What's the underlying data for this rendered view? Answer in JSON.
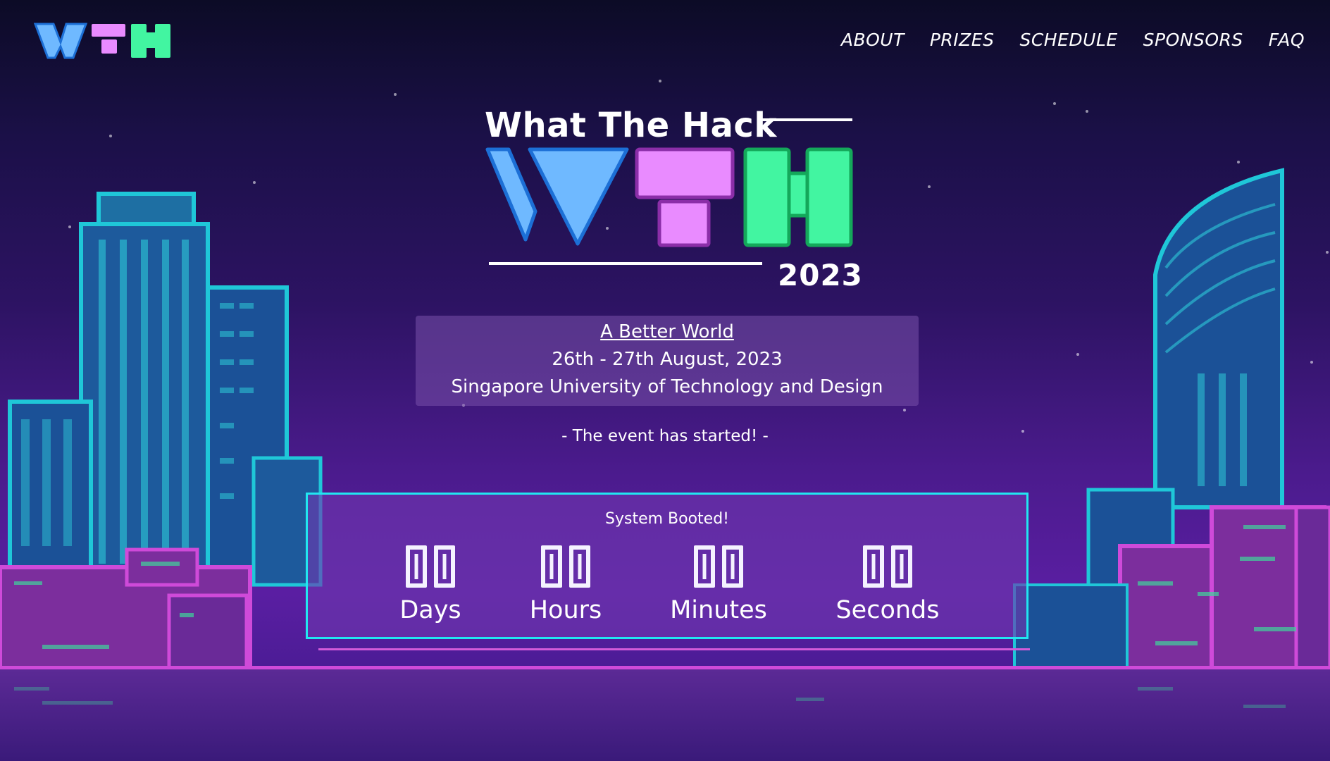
{
  "nav": {
    "logo_alt": "WTH",
    "items": [
      {
        "label": "ABOUT"
      },
      {
        "label": "PRIZES"
      },
      {
        "label": "SCHEDULE"
      },
      {
        "label": "SPONSORS"
      },
      {
        "label": "FAQ"
      }
    ]
  },
  "hero": {
    "title": "What The Hack",
    "year": "2023"
  },
  "event": {
    "theme": "A Better World",
    "dates": "26th - 27th August, 2023",
    "venue": "Singapore University of Technology and Design",
    "status": "- The event has started! -"
  },
  "countdown": {
    "title": "System Booted!",
    "units": [
      {
        "value": "00",
        "label": "Days"
      },
      {
        "value": "00",
        "label": "Hours"
      },
      {
        "value": "00",
        "label": "Minutes"
      },
      {
        "value": "00",
        "label": "Seconds"
      }
    ]
  },
  "colors": {
    "logo_w": "#6fb9ff",
    "logo_t": "#e98bff",
    "logo_h": "#42f5a1",
    "countdown_border": "#21e6f1",
    "accent_magenta": "#d25bd9"
  }
}
